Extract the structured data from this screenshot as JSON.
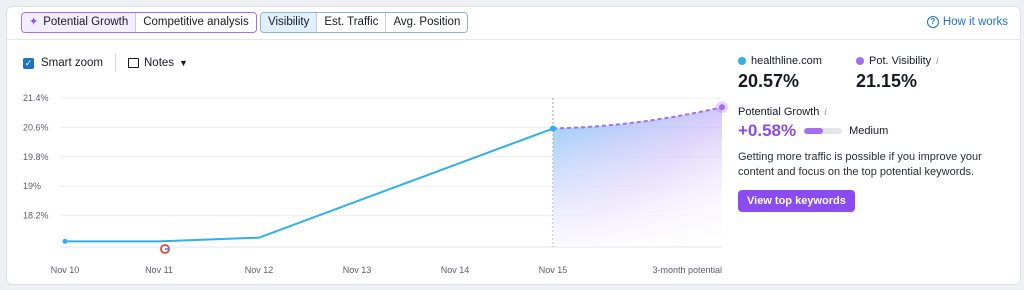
{
  "tabs_left": [
    {
      "label": "Potential Growth",
      "active": true
    },
    {
      "label": "Competitive analysis",
      "active": false
    }
  ],
  "tabs_metric": [
    {
      "label": "Visibility",
      "active": true
    },
    {
      "label": "Est. Traffic",
      "active": false
    },
    {
      "label": "Avg. Position",
      "active": false
    }
  ],
  "how_it_works": "How it works",
  "controls": {
    "smart_zoom_label": "Smart zoom",
    "smart_zoom_checked": true,
    "notes_label": "Notes"
  },
  "colors": {
    "brand_blue": "#1a73c6",
    "series_blue": "#2fb0ec",
    "potential_purple": "#a56ef1",
    "accent_purple": "#8a4cf0"
  },
  "legend": {
    "domain": {
      "label": "healthline.com",
      "value": "20.57%"
    },
    "potential": {
      "label": "Pot. Visibility",
      "value": "21.15%"
    }
  },
  "potential_growth": {
    "title": "Potential Growth",
    "value": "+0.58%",
    "level": "Medium",
    "level_fraction": 0.5,
    "description": "Getting more traffic is possible if you improve your content and focus on the top potential keywords.",
    "cta": "View top keywords"
  },
  "chart_data": {
    "type": "line",
    "x": [
      "Nov 10",
      "Nov 11",
      "Nov 12",
      "Nov 13",
      "Nov 14",
      "Nov 15",
      "3-month potential"
    ],
    "y_ticks": [
      "21.4%",
      "20.6%",
      "19.8%",
      "19%",
      "18.2%"
    ],
    "y_tick_values": [
      21.4,
      20.6,
      19.8,
      19.0,
      18.2
    ],
    "ylim": [
      17.4,
      21.4
    ],
    "series": [
      {
        "name": "healthline.com",
        "values": [
          17.5,
          17.5,
          17.6,
          null,
          null,
          20.57,
          null
        ]
      },
      {
        "name": "Pot. Visibility",
        "values": [
          null,
          null,
          null,
          null,
          null,
          20.57,
          21.15
        ]
      }
    ],
    "markers": [
      {
        "x": "Nov 11",
        "icon": "google-icon"
      }
    ],
    "grid": true
  }
}
